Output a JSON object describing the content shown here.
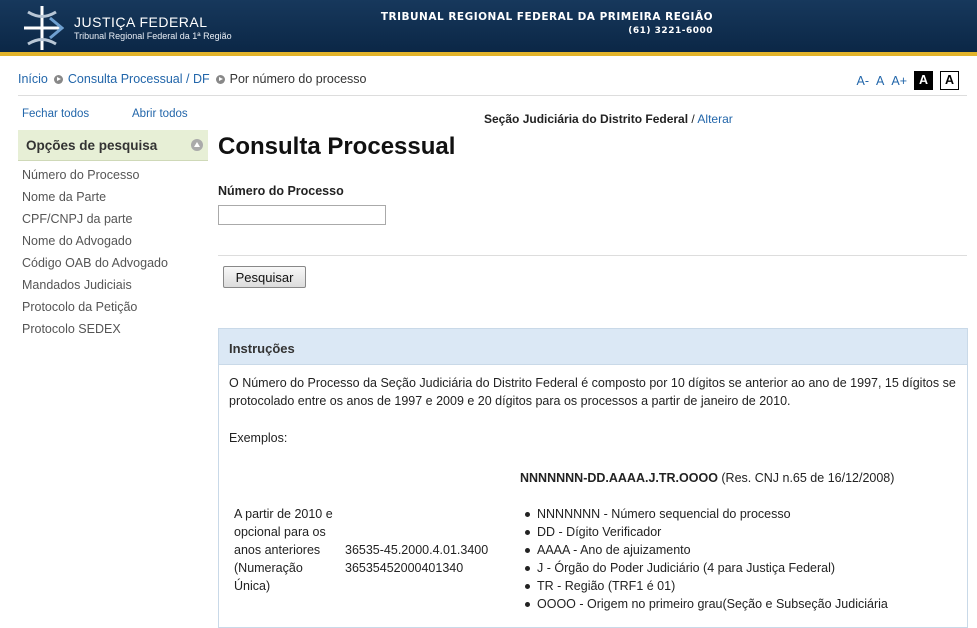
{
  "header": {
    "logo_line1": "JUSTIÇA FEDERAL",
    "logo_line2": "Tribunal Regional Federal da 1ª Região",
    "tribunal_name": "TRIBUNAL REGIONAL FEDERAL DA PRIMEIRA REGIÃO",
    "phone": "(61) 3221-6000"
  },
  "breadcrumb": {
    "home": "Início",
    "consulta": "Consulta Processual / DF",
    "current": "Por número do processo"
  },
  "font_controls": {
    "decrease": "A-",
    "normal": "A",
    "increase": "A+",
    "contrast_dark": "A",
    "contrast_light": "A"
  },
  "sidebar": {
    "collapse_all": "Fechar todos",
    "expand_all": "Abrir todos",
    "section_title": "Opções de pesquisa",
    "items": [
      {
        "label": "Número do Processo"
      },
      {
        "label": "Nome da Parte"
      },
      {
        "label": "CPF/CNPJ da parte"
      },
      {
        "label": "Nome do Advogado"
      },
      {
        "label": "Código OAB do Advogado"
      },
      {
        "label": "Mandados Judiciais"
      },
      {
        "label": "Protocolo da Petição"
      },
      {
        "label": "Protocolo SEDEX"
      }
    ]
  },
  "main": {
    "secao": "Seção Judiciária do Distrito Federal",
    "secao_sep": " / ",
    "alterar": "Alterar",
    "title": "Consulta Processual",
    "field_label": "Número do Processo",
    "field_value": "",
    "search_button": "Pesquisar"
  },
  "instructions": {
    "title": "Instruções",
    "text": "O Número do Processo da Seção Judiciária do Distrito Federal é composto por 10 dígitos se anterior ao ano de 1997, 15 dígitos se protocolado entre os anos de 1997 e 2009 e 20 dígitos para os processos a partir de janeiro de 2010.",
    "examples_label": "Exemplos:",
    "format_code": "NNNNNNN-DD.AAAA.J.TR.OOOO",
    "format_note": " (Res. CNJ n.65 de 16/12/2008)",
    "left_lines": [
      "A partir de 2010 e",
      "opcional para os",
      "anos anteriores",
      "(Numeração",
      "Única)"
    ],
    "example_numbers": [
      "36535-45.2000.4.01.3400",
      "36535452000401340"
    ],
    "bullets": [
      "NNNNNNN - Número sequencial do processo",
      "DD - Dígito Verificador",
      "AAAA - Ano de ajuizamento",
      "J - Órgão do Poder Judiciário (4 para Justiça Federal)",
      "TR - Região (TRF1 é 01)",
      "OOOO - Origem no primeiro grau(Seção e Subseção Judiciária"
    ]
  }
}
